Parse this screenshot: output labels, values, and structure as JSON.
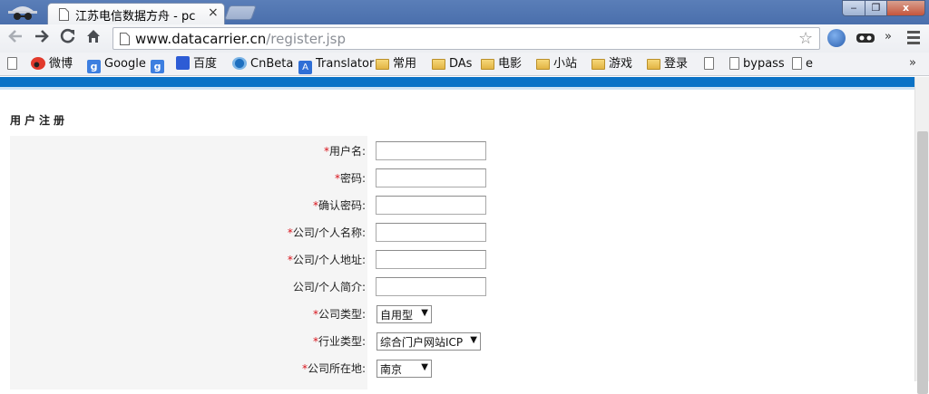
{
  "browser": {
    "tab_title": "江苏电信数据方舟 - pc",
    "tab_close": "×",
    "url_host": "www.datacarrier.cn",
    "url_path": "/register.jsp",
    "ext_more": "»",
    "win_min": "‒",
    "win_max": "❐",
    "win_close": "x"
  },
  "bookmarks": {
    "items": [
      {
        "label": "微博",
        "icon": "weibo-icon"
      },
      {
        "label": "Google",
        "icon": "google-icon"
      },
      {
        "label": "",
        "icon": "google-icon"
      },
      {
        "label": "百度",
        "icon": "baidu-icon"
      },
      {
        "label": "CnBeta",
        "icon": "cnbeta-icon"
      },
      {
        "label": "Translator",
        "icon": "translator-icon"
      },
      {
        "label": "常用",
        "icon": "folder-icon"
      },
      {
        "label": "DAs",
        "icon": "folder-icon"
      },
      {
        "label": "电影",
        "icon": "folder-icon"
      },
      {
        "label": "小站",
        "icon": "folder-icon"
      },
      {
        "label": "游戏",
        "icon": "folder-icon"
      },
      {
        "label": "登录",
        "icon": "folder-icon"
      },
      {
        "label": "",
        "icon": "page-icon"
      },
      {
        "label": "bypass",
        "icon": "page-icon"
      },
      {
        "label": "e",
        "icon": "page-icon"
      }
    ],
    "more": "»"
  },
  "page": {
    "section_title": "用户注册",
    "accent_color": "#0a72c6",
    "required_mark": "*",
    "fields": [
      {
        "label": "用户名:",
        "required": true,
        "type": "text",
        "value": ""
      },
      {
        "label": "密码:",
        "required": true,
        "type": "password",
        "value": ""
      },
      {
        "label": "确认密码:",
        "required": true,
        "type": "password",
        "value": ""
      },
      {
        "label": "公司/个人名称:",
        "required": true,
        "type": "text",
        "value": ""
      },
      {
        "label": "公司/个人地址:",
        "required": true,
        "type": "text",
        "value": ""
      },
      {
        "label": "公司/个人简介:",
        "required": false,
        "type": "text",
        "value": ""
      },
      {
        "label": "公司类型:",
        "required": true,
        "type": "select",
        "value": "自用型"
      },
      {
        "label": "行业类型:",
        "required": true,
        "type": "select",
        "value": "综合门户网站ICP"
      },
      {
        "label": "公司所在地:",
        "required": true,
        "type": "select",
        "value": "南京"
      }
    ]
  }
}
